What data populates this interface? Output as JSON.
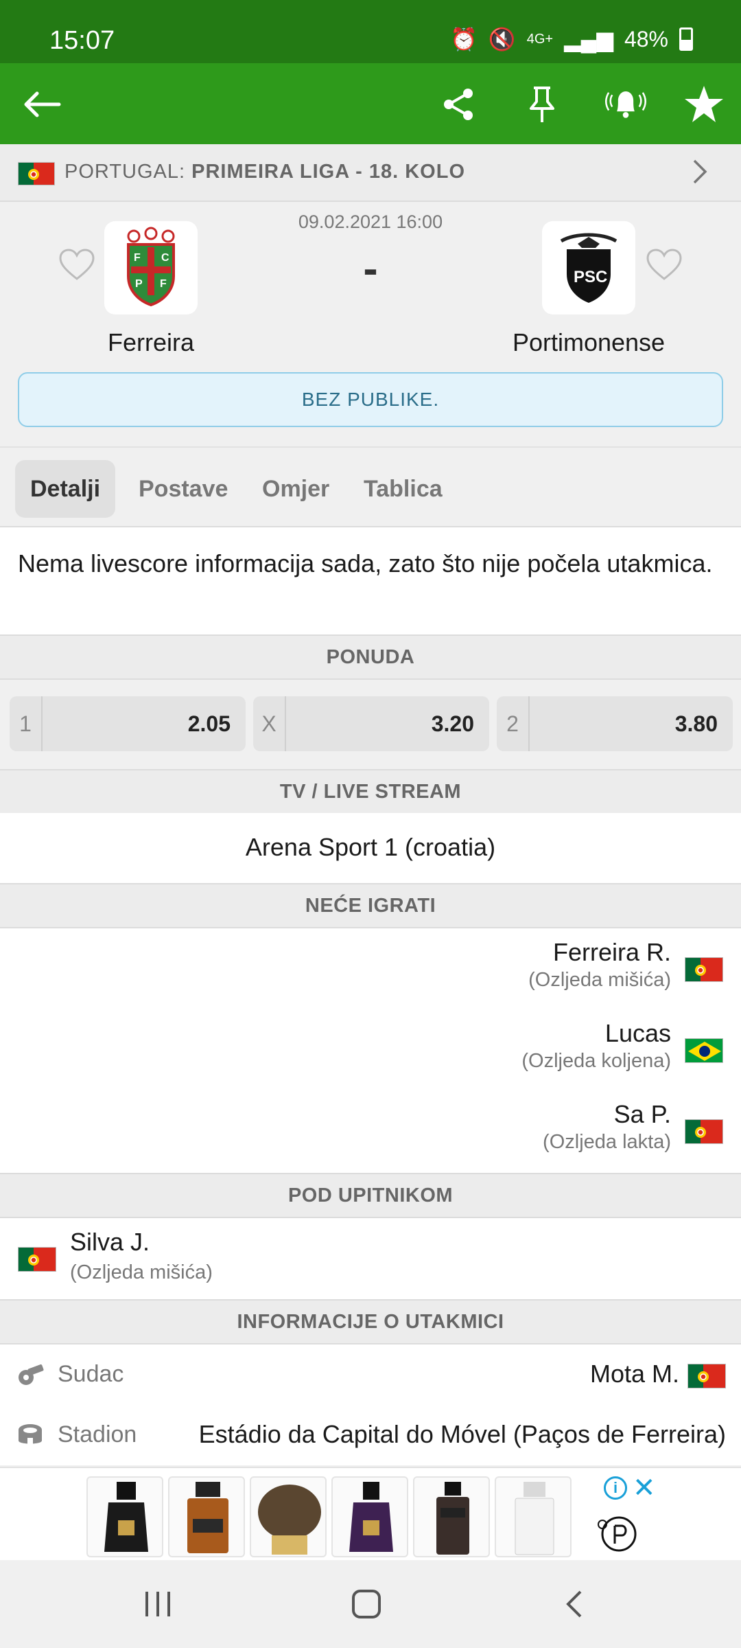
{
  "status_bar": {
    "time": "15:07",
    "network": "4G+",
    "battery": "48%",
    "battery_level": 0.48
  },
  "app_bar": {
    "icons": [
      "back-arrow-icon",
      "share-icon",
      "pin-icon",
      "notification-bell-icon",
      "favorite-star-icon"
    ],
    "colors": {
      "status_bar": "#237a14",
      "app_bar": "#2e9a1b"
    }
  },
  "league": {
    "country": "PORTUGAL:",
    "name": "PRIMEIRA LIGA - 18. KOLO"
  },
  "match": {
    "datetime": "09.02.2021 16:00",
    "score": "-",
    "home_team": "Ferreira",
    "away_team": "Portimonense",
    "notice": "BEZ PUBLIKE."
  },
  "tabs": [
    "Detalji",
    "Postave",
    "Omjer",
    "Tablica"
  ],
  "info_message": "Nema livescore informacija sada, zato što nije počela utakmica.",
  "sections": {
    "odds": "PONUDA",
    "tv": "TV / LIVE STREAM",
    "missing": "NEĆE IGRATI",
    "doubtful": "POD UPITNIKOM",
    "match_info": "INFORMACIJE O UTAKMICI"
  },
  "odds": [
    {
      "label": "1",
      "value": "2.05"
    },
    {
      "label": "X",
      "value": "3.20"
    },
    {
      "label": "2",
      "value": "3.80"
    }
  ],
  "tv_channel": "Arena Sport 1 (croatia)",
  "missing_players": [
    {
      "name": "Ferreira R.",
      "reason": "(Ozljeda mišića)",
      "flag": "portugal"
    },
    {
      "name": "Lucas",
      "reason": "(Ozljeda koljena)",
      "flag": "brazil"
    },
    {
      "name": "Sa P.",
      "reason": "(Ozljeda lakta)",
      "flag": "portugal"
    }
  ],
  "doubtful_players": [
    {
      "name": "Silva J.",
      "reason": "(Ozljeda mišića)",
      "flag": "portugal"
    }
  ],
  "match_info": {
    "referee_label": "Sudac",
    "referee_value": "Mota M.",
    "stadium_label": "Stadion",
    "stadium_value": "Estádio da Capital do Móvel (Paços de Ferreira)"
  },
  "ad": {
    "info_icon": "ad-info-icon",
    "close_icon": "ad-close-icon"
  },
  "nav_bar": [
    "recent-apps-icon",
    "home-icon",
    "back-icon"
  ]
}
